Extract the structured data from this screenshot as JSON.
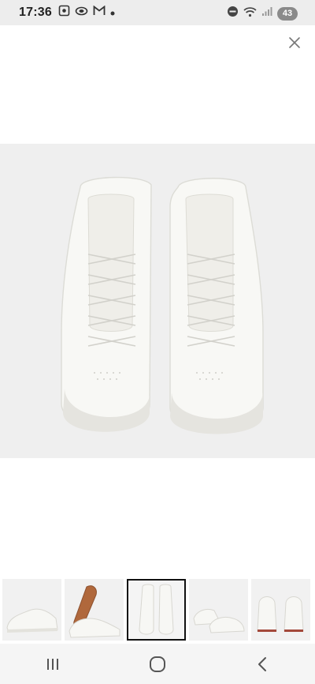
{
  "status_bar": {
    "time": "17:36",
    "left_icons": [
      "screenshot-icon",
      "link-icon",
      "gmail-icon",
      "dot-icon"
    ],
    "right_icons": [
      "dnd-icon",
      "wifi-icon",
      "signal-icon"
    ],
    "battery": "43"
  },
  "viewer": {
    "close_icon": "close-icon",
    "main_image": "white-sneakers-top-view",
    "selected_index": 2,
    "thumbnails": [
      {
        "name": "sneaker-side-view"
      },
      {
        "name": "sneaker-sole-view"
      },
      {
        "name": "sneaker-top-view"
      },
      {
        "name": "sneaker-angled-pair-view"
      },
      {
        "name": "sneaker-back-view"
      }
    ]
  },
  "navigation": {
    "buttons": [
      "recent-apps",
      "home",
      "back"
    ]
  },
  "colors": {
    "status_bar_bg": "#ededed",
    "image_bg": "#efefef",
    "thumb_border_active": "#111111"
  }
}
